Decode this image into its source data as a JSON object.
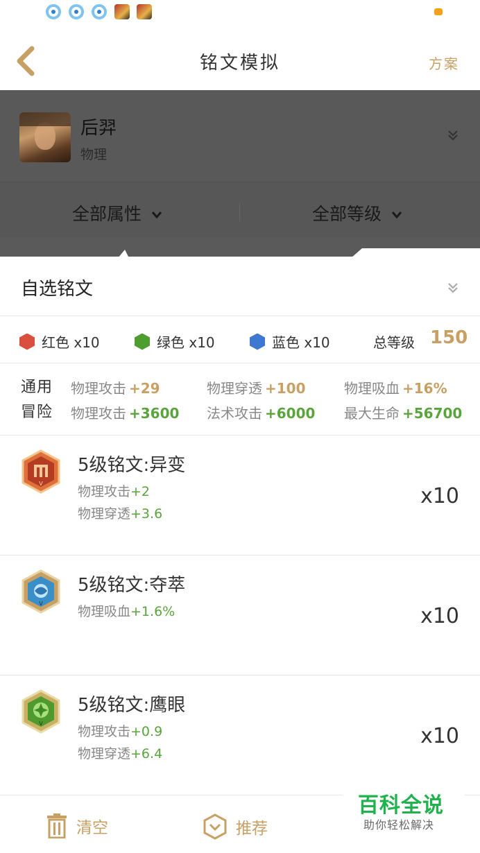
{
  "status_bar": {
    "icons": [
      "qq-icon",
      "qq-icon",
      "qq-icon",
      "game-icon",
      "game-icon"
    ],
    "battery_color": "#f4a11a"
  },
  "nav": {
    "title": "铭文模拟",
    "plan_label": "方案",
    "accent": "#c9a064"
  },
  "hero": {
    "name": "后羿",
    "type": "物理"
  },
  "filters": {
    "attribute": "全部属性",
    "level": "全部等级"
  },
  "panel": {
    "custom_title": "自选铭文",
    "colors": [
      {
        "label": "红色 x10",
        "color": "#d9503f"
      },
      {
        "label": "绿色 x10",
        "color": "#4e9e2f"
      },
      {
        "label": "蓝色 x10",
        "color": "#3f78d0"
      }
    ],
    "total_label": "总等级",
    "total_value": "150",
    "stats": {
      "general_label": "通用",
      "adventure_label": "冒险",
      "general": [
        {
          "name": "物理攻击",
          "value": "+29"
        },
        {
          "name": "物理穿透",
          "value": "+100"
        },
        {
          "name": "物理吸血",
          "value": "+16%"
        }
      ],
      "adventure": [
        {
          "name": "物理攻击",
          "value": "+3600"
        },
        {
          "name": "法术攻击",
          "value": "+6000"
        },
        {
          "name": "最大生命",
          "value": "+56700"
        }
      ]
    },
    "runes": [
      {
        "name": "5级铭文:异变",
        "count": "x10",
        "attrs": [
          {
            "name": "物理攻击",
            "value": "+2"
          },
          {
            "name": "物理穿透",
            "value": "+3.6"
          }
        ]
      },
      {
        "name": "5级铭文:夺萃",
        "count": "x10",
        "attrs": [
          {
            "name": "物理吸血",
            "value": "+1.6%"
          }
        ]
      },
      {
        "name": "5级铭文:鹰眼",
        "count": "x10",
        "attrs": [
          {
            "name": "物理攻击",
            "value": "+0.9"
          },
          {
            "name": "物理穿透",
            "value": "+6.4"
          }
        ]
      }
    ]
  },
  "bottom_bar": {
    "clear_label": "清空",
    "recommend_label": "推荐"
  },
  "watermark": {
    "main": "百科全说",
    "sub": "助你轻松解决"
  }
}
